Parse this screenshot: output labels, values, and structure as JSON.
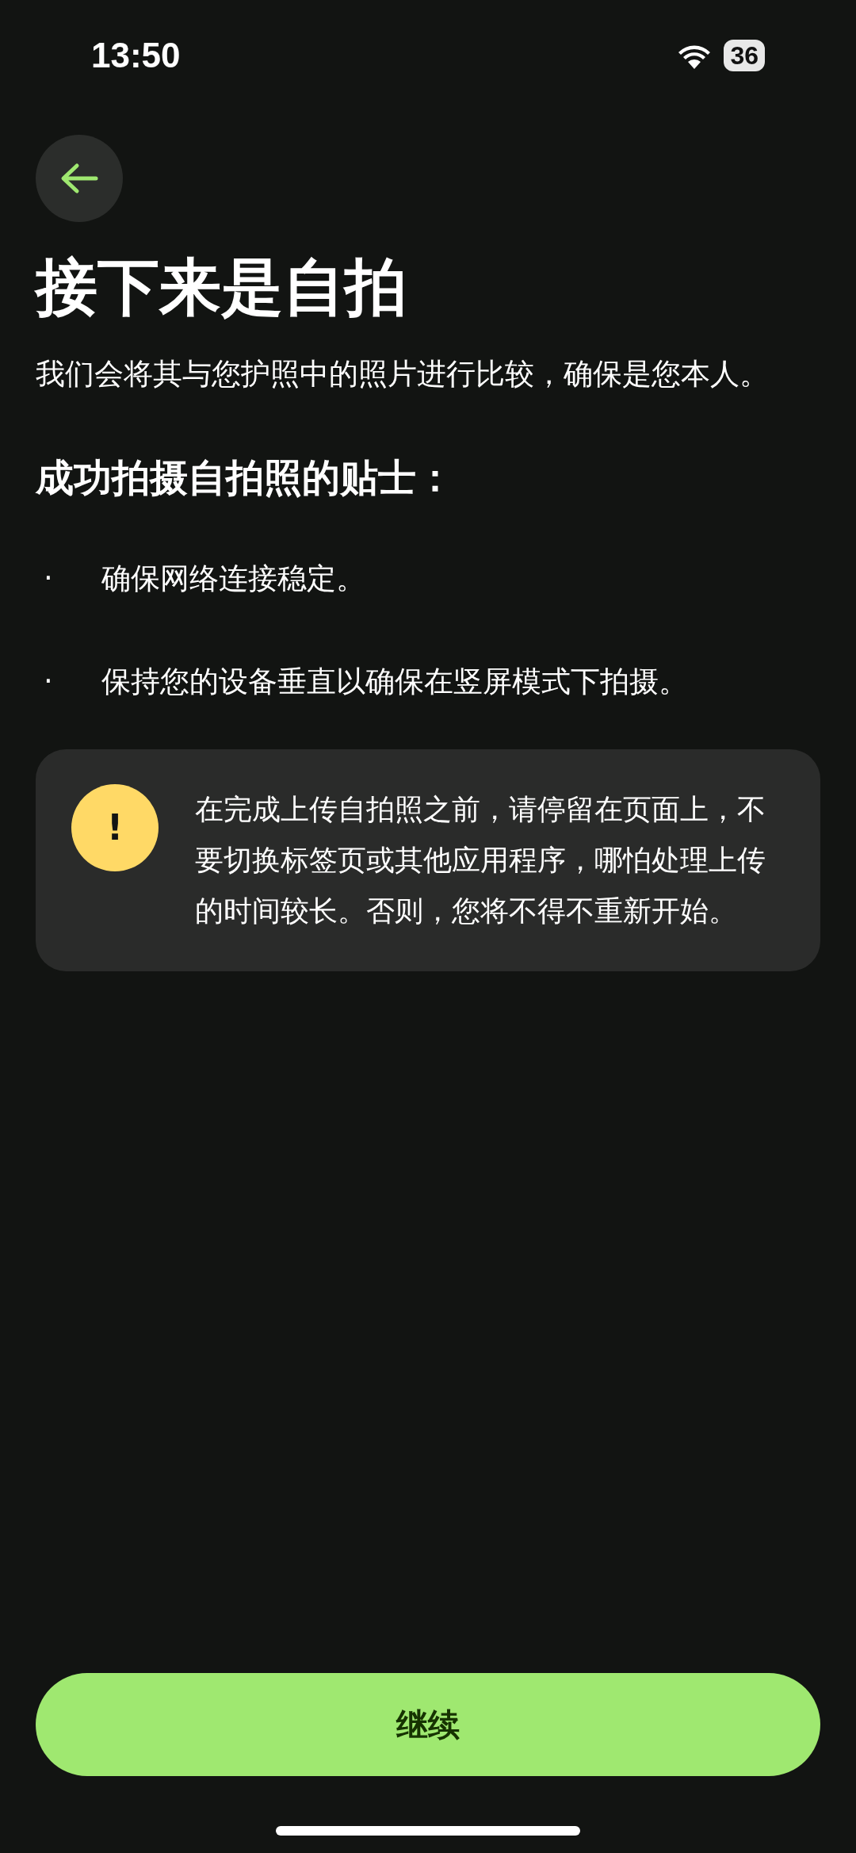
{
  "status_bar": {
    "time": "13:50",
    "battery": "36"
  },
  "title": "接下来是自拍",
  "subtitle": "我们会将其与您护照中的照片进行比较，确保是您本人。",
  "tips_heading": "成功拍摄自拍照的贴士：",
  "tips": [
    {
      "bullet": "·",
      "text": "确保网络连接稳定。"
    },
    {
      "bullet": "·",
      "text": "保持您的设备垂直以确保在竖屏模式下拍摄。"
    }
  ],
  "notice": {
    "icon": "!",
    "text": "在完成上传自拍照之前，请停留在页面上，不要切换标签页或其他应用程序，哪怕处理上传的时间较长。否则，您将不得不重新开始。"
  },
  "continue_button": "继续"
}
